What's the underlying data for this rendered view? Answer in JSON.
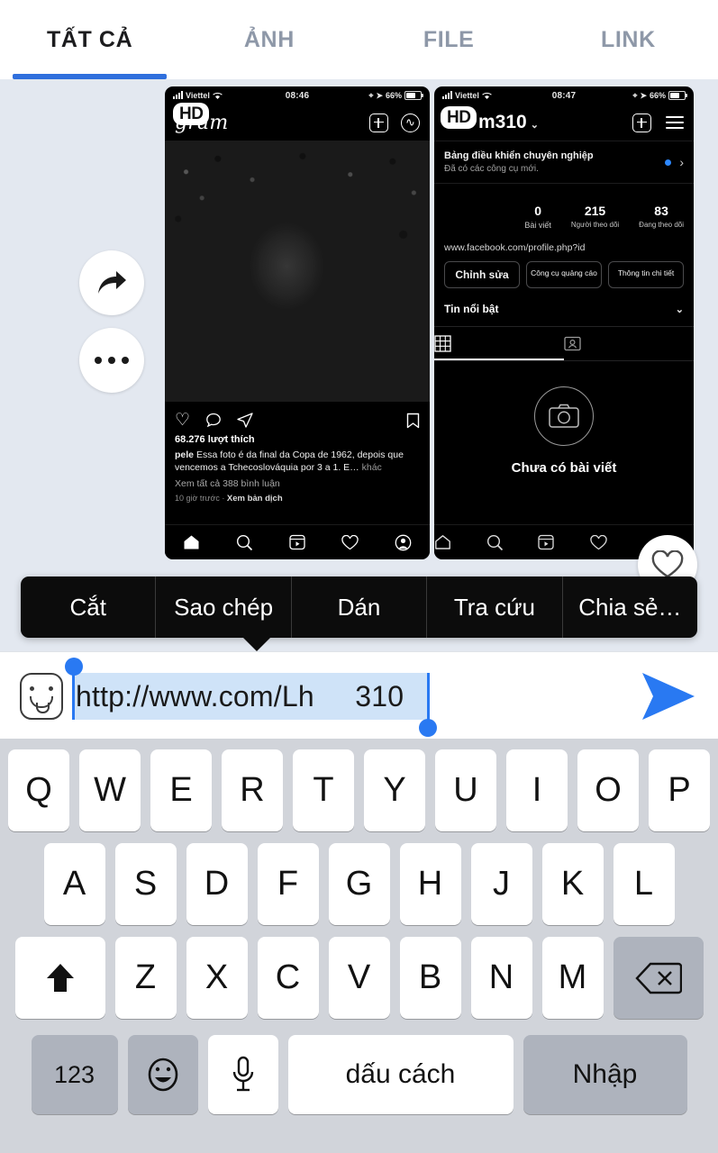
{
  "tabs": [
    {
      "label": "TẤT CẢ",
      "active": true
    },
    {
      "label": "ẢNH",
      "active": false
    },
    {
      "label": "FILE",
      "active": false
    },
    {
      "label": "LINK",
      "active": false
    }
  ],
  "accent_color": "#2f6fdd",
  "background_color": "#e3e8f0",
  "message_actions": {
    "forward_icon": "forward-arrow-icon",
    "more_icon": "more-options-icon"
  },
  "attachments": {
    "left_screenshot": {
      "status_bar": {
        "carrier": "Viettel",
        "time": "08:46",
        "battery": "66%"
      },
      "app_name": "gram",
      "hd_badge": "HD",
      "likes": "68.276 lượt thích",
      "caption_author": "pele",
      "caption_text": "Essa foto é da final da Copa de 1962, depois que vencemos a Tchecoslováquia por 3 a 1. E…",
      "caption_more": "khác",
      "comments": "Xem tất cả 388 bình luận",
      "time_ago": "10 giờ trước",
      "translate": "Xem bản dịch",
      "nav_icons": [
        "home-icon",
        "search-icon",
        "reels-icon",
        "heart-icon",
        "profile-icon"
      ]
    },
    "right_screenshot": {
      "status_bar": {
        "carrier": "Viettel",
        "time": "08:47",
        "battery": "66%"
      },
      "hd_badge": "HD",
      "profile_name": "m310",
      "pro_banner_title": "Bảng điều khiển chuyên nghiệp",
      "pro_banner_sub": "Đã có các công cụ mới.",
      "stats": [
        {
          "num": "0",
          "label": "Bài viết"
        },
        {
          "num": "215",
          "label": "Người theo dõi"
        },
        {
          "num": "83",
          "label": "Đang theo dõi"
        }
      ],
      "website": "www.facebook.com/profile.php?id",
      "buttons": [
        "Chỉnh sửa",
        "Công cụ quảng cáo",
        "Thông tin chi tiết"
      ],
      "highlights": "Tin nổi bật",
      "segments": [
        "grid-icon",
        "tagged-icon"
      ],
      "empty_state": "Chưa có bài viết",
      "nav_icons": [
        "home-icon",
        "search-icon",
        "reels-icon",
        "heart-icon"
      ]
    }
  },
  "heart_fab": "heart-reaction-icon",
  "context_menu": {
    "items": [
      "Cắt",
      "Sao chép",
      "Dán",
      "Tra cứu",
      "Chia sẻ…"
    ]
  },
  "input_bar": {
    "emoji_button": "emoji-sticker-icon",
    "text_value": "http://www.com/Lh     310",
    "selected": true,
    "selection_color": "#cfe3f8",
    "handle_color": "#2979f2",
    "send_button": "send-icon",
    "send_color": "#2979f2"
  },
  "keyboard": {
    "row1": [
      "Q",
      "W",
      "E",
      "R",
      "T",
      "Y",
      "U",
      "I",
      "O",
      "P"
    ],
    "row2": [
      "A",
      "S",
      "D",
      "F",
      "G",
      "H",
      "J",
      "K",
      "L"
    ],
    "row3_shift": "shift-icon",
    "row3": [
      "Z",
      "X",
      "C",
      "V",
      "B",
      "N",
      "M"
    ],
    "row3_backspace": "backspace-icon",
    "numbers_key": "123",
    "emoji_key": "emoji-keyboard-icon",
    "mic_key": "microphone-icon",
    "space_key": "dấu cách",
    "enter_key": "Nhập"
  }
}
